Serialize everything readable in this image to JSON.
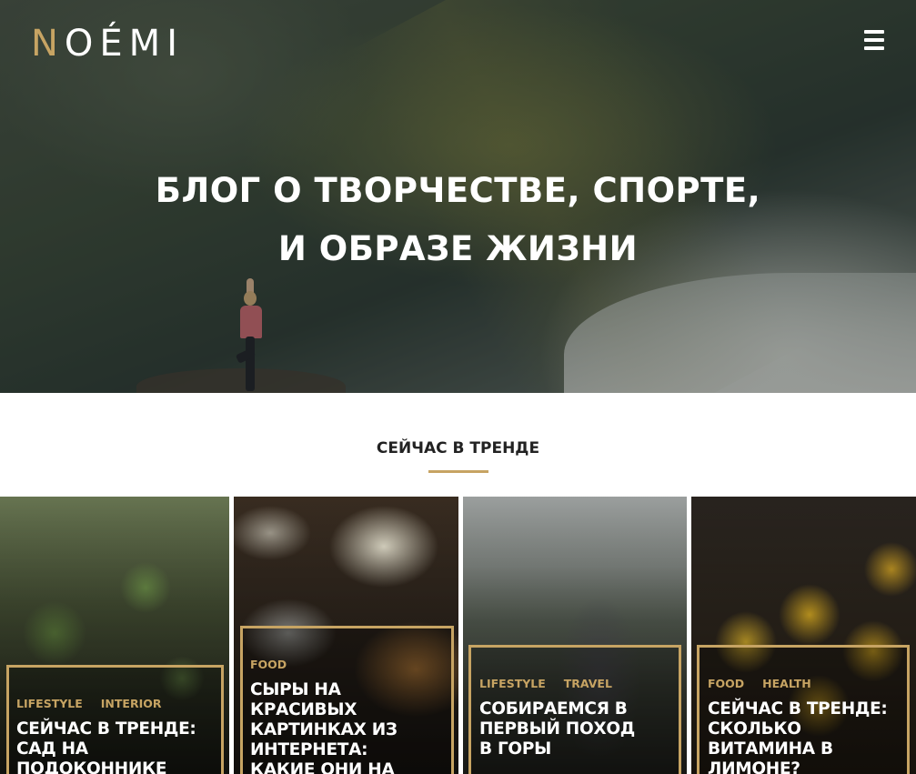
{
  "header": {
    "logo_first": "N",
    "logo_rest": "OÉMI"
  },
  "hero": {
    "title_line1": "БЛОГ О ТВОРЧЕСТВЕ, СПОРТЕ,",
    "title_line2": "И ОБРАЗЕ ЖИЗНИ"
  },
  "trending": {
    "title": "СЕЙЧАС В ТРЕНДЕ",
    "cards": [
      {
        "categories": [
          "LIFESTYLE",
          "INTERIOR"
        ],
        "title": "СЕЙЧАС В ТРЕНДЕ: САД НА ПОДОКОННИКЕ"
      },
      {
        "categories": [
          "FOOD"
        ],
        "title": "СЫРЫ НА КРАСИВЫХ КАРТИНКАХ ИЗ ИНТЕРНЕТА: КАКИЕ ОНИ НА ВКУС?"
      },
      {
        "categories": [
          "LIFESTYLE",
          "TRAVEL"
        ],
        "title": "СОБИРАЕМСЯ В ПЕРВЫЙ ПОХОД В ГОРЫ"
      },
      {
        "categories": [
          "FOOD",
          "HEALTH"
        ],
        "title": "СЕЙЧАС В ТРЕНДЕ: СКОЛЬКО ВИТАМИНА В ЛИМОНЕ?"
      }
    ]
  },
  "colors": {
    "accent": "#c7a463"
  },
  "icons": {
    "menu": "hamburger-menu-icon"
  }
}
